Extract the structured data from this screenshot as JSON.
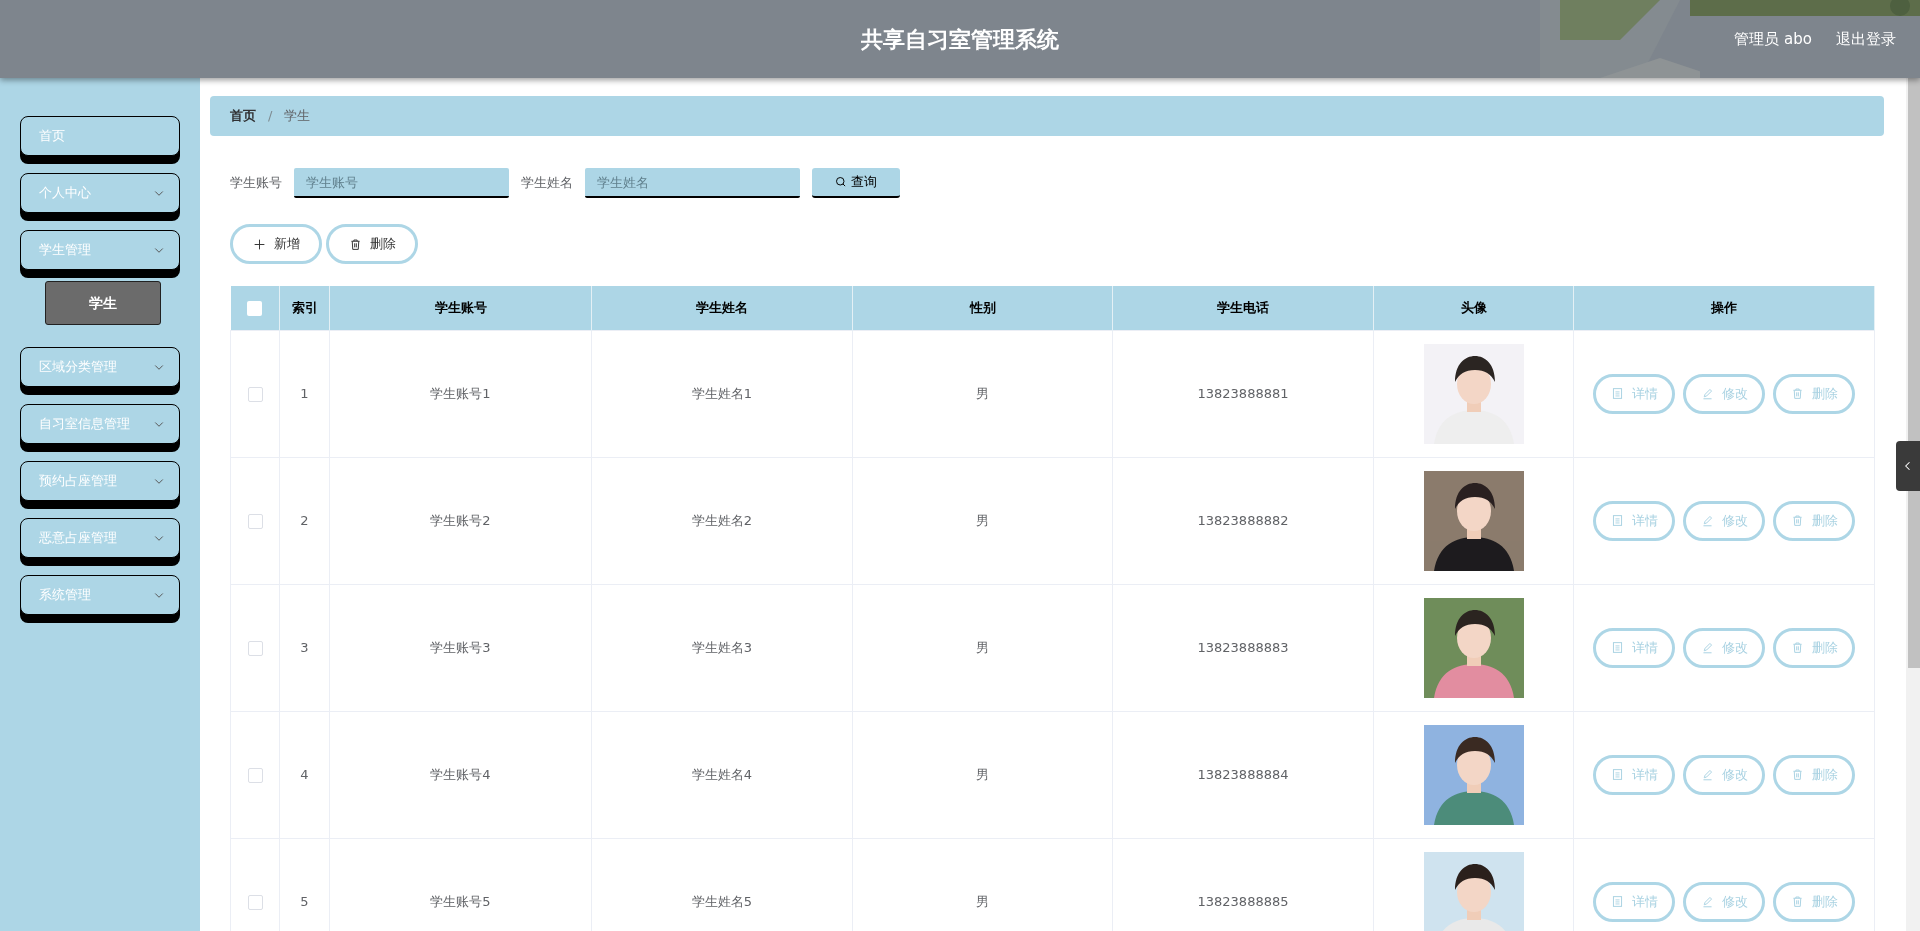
{
  "header": {
    "title": "共享自习室管理系统",
    "user": "管理员 abo",
    "logout": "退出登录"
  },
  "sidebar": {
    "items": [
      {
        "label": "首页",
        "kind": "link"
      },
      {
        "label": "个人中心",
        "kind": "menu"
      },
      {
        "label": "学生管理",
        "kind": "menu",
        "children": [
          {
            "label": "学生",
            "selected": true
          }
        ]
      },
      {
        "label": "区域分类管理",
        "kind": "menu"
      },
      {
        "label": "自习室信息管理",
        "kind": "menu"
      },
      {
        "label": "预约占座管理",
        "kind": "menu"
      },
      {
        "label": "恶意占座管理",
        "kind": "menu"
      },
      {
        "label": "系统管理",
        "kind": "menu"
      }
    ]
  },
  "breadcrumb": {
    "separator": "/",
    "items": [
      {
        "label": "首页"
      },
      {
        "label": "学生"
      }
    ]
  },
  "search": {
    "fields": [
      {
        "label": "学生账号",
        "placeholder": "学生账号"
      },
      {
        "label": "学生姓名",
        "placeholder": "学生姓名"
      }
    ],
    "button": "查询"
  },
  "toolbar": [
    {
      "label": "新增",
      "kind": "add"
    },
    {
      "label": "删除",
      "kind": "delete"
    }
  ],
  "table": {
    "select_all": {
      "checked": false
    },
    "columns": [
      "索引",
      "学生账号",
      "学生姓名",
      "性别",
      "学生电话",
      "头像",
      "操作"
    ],
    "rows": [
      {
        "checked": false,
        "index": "1",
        "account": "学生账号1",
        "name": "学生姓名1",
        "gender": "男",
        "phone": "13823888881",
        "actions": [
          {
            "label": "详情",
            "kind": "detail"
          },
          {
            "label": "修改",
            "kind": "edit"
          },
          {
            "label": "删除",
            "kind": "delete"
          }
        ]
      },
      {
        "checked": false,
        "index": "2",
        "account": "学生账号2",
        "name": "学生姓名2",
        "gender": "男",
        "phone": "13823888882",
        "actions": [
          {
            "label": "详情",
            "kind": "detail"
          },
          {
            "label": "修改",
            "kind": "edit"
          },
          {
            "label": "删除",
            "kind": "delete"
          }
        ]
      },
      {
        "checked": false,
        "index": "3",
        "account": "学生账号3",
        "name": "学生姓名3",
        "gender": "男",
        "phone": "13823888883",
        "actions": [
          {
            "label": "详情",
            "kind": "detail"
          },
          {
            "label": "修改",
            "kind": "edit"
          },
          {
            "label": "删除",
            "kind": "delete"
          }
        ]
      },
      {
        "checked": false,
        "index": "4",
        "account": "学生账号4",
        "name": "学生姓名4",
        "gender": "男",
        "phone": "13823888884",
        "actions": [
          {
            "label": "详情",
            "kind": "detail"
          },
          {
            "label": "修改",
            "kind": "edit"
          },
          {
            "label": "删除",
            "kind": "delete"
          }
        ]
      },
      {
        "checked": false,
        "index": "5",
        "account": "学生账号5",
        "name": "学生姓名5",
        "gender": "男",
        "phone": "13823888885",
        "actions": [
          {
            "label": "详情",
            "kind": "detail"
          },
          {
            "label": "修改",
            "kind": "edit"
          },
          {
            "label": "删除",
            "kind": "delete"
          }
        ]
      }
    ]
  }
}
